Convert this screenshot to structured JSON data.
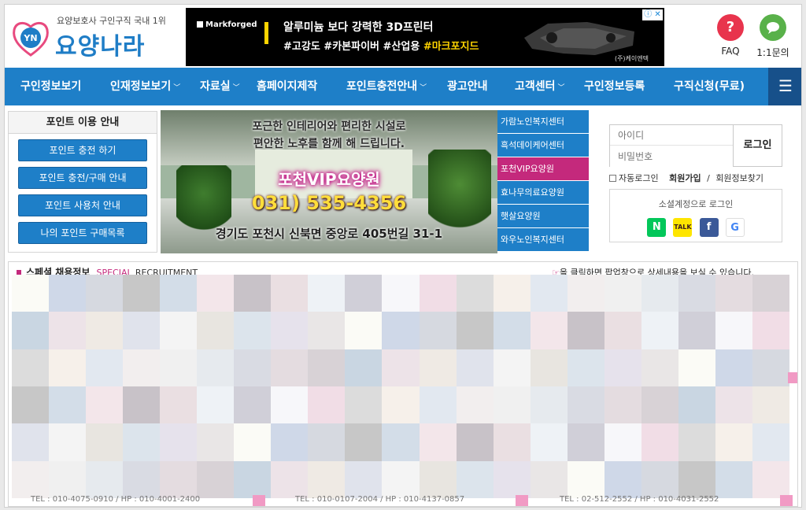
{
  "header": {
    "logo_badge": "YN",
    "logo_sub": "요양보호사 구인구직 국내 1위",
    "logo_name": "요양나라",
    "faq_label": "FAQ",
    "inquiry_label": "1:1문의"
  },
  "ad": {
    "brand": "Markforged",
    "line1": "알루미늄 보다 강력한 3D프린터",
    "line2_prefix": "#고강도 #카본파이버 #산업용 ",
    "line2_highlight": "#마크포지드",
    "footer": "(주)케이엔텍",
    "corner": "ⓘ ✕"
  },
  "nav": {
    "items": [
      {
        "label": "구인정보보기",
        "chevron": false
      },
      {
        "label": "인재정보보기",
        "chevron": true
      },
      {
        "label": "자료실",
        "chevron": true
      },
      {
        "label": "홈페이지제작",
        "chevron": false
      },
      {
        "label": "포인트충전안내",
        "chevron": true
      },
      {
        "label": "광고안내",
        "chevron": false
      },
      {
        "label": "고객센터",
        "chevron": true
      },
      {
        "label": "구인정보등록",
        "chevron": false
      },
      {
        "label": "구직신청(무료)",
        "chevron": false
      }
    ],
    "menu_icon": "hamburger-icon"
  },
  "points": {
    "title": "포인트 이용 안내",
    "buttons": [
      "포인트 충전 하기",
      "포인트 충전/구매 안내",
      "포인트 사용처 안내",
      "나의 포인트 구매목록"
    ]
  },
  "banner": {
    "line1": "포근한 인테리어와 편리한 시설로",
    "line2": "편안한 노후를 함께 해 드립니다.",
    "name": "포천VIP요양원",
    "phone": "031) 535-4356",
    "address": "경기도 포천시 신북면 중앙로 405번길 31-1"
  },
  "facilities": [
    {
      "label": "가람노인복지센터",
      "active": false
    },
    {
      "label": "흑석데이케어센터",
      "active": false
    },
    {
      "label": "포천VIP요양원",
      "active": true
    },
    {
      "label": "효나무의료요양원",
      "active": false
    },
    {
      "label": "햇살요양원",
      "active": false
    },
    {
      "label": "와우노인복지센터",
      "active": false
    }
  ],
  "login": {
    "id_placeholder": "아이디",
    "pw_placeholder": "비밀번호",
    "button": "로그인",
    "auto_login": "자동로그인",
    "join": "회원가입",
    "separator": "/",
    "find": "회원정보찾기",
    "social_label": "소셜계정으로 로그인",
    "social_icons": [
      "naver-icon",
      "kakao-icon",
      "facebook-icon",
      "google-icon"
    ]
  },
  "special": {
    "title": "스페셜 채용정보",
    "eng1": "SPECIAL",
    "eng2": "RECRUITMENT",
    "notice": "을 클릭하면 팝업창으로 상세내용을 보실 수 있습니다.",
    "footers": [
      "TEL : 010-4075-0910 / HP : 010-4001-2400",
      "TEL : 010-0107-2004 / HP : 010-4137-0857",
      "TEL : 02-512-2552 / HP : 010-4031-2552"
    ]
  },
  "colors": {
    "brand_blue": "#1e7fc8",
    "nav_dark": "#17508a",
    "accent_pink": "#c4297c",
    "faq_red": "#e8344d",
    "inquiry_green": "#59b14a"
  }
}
